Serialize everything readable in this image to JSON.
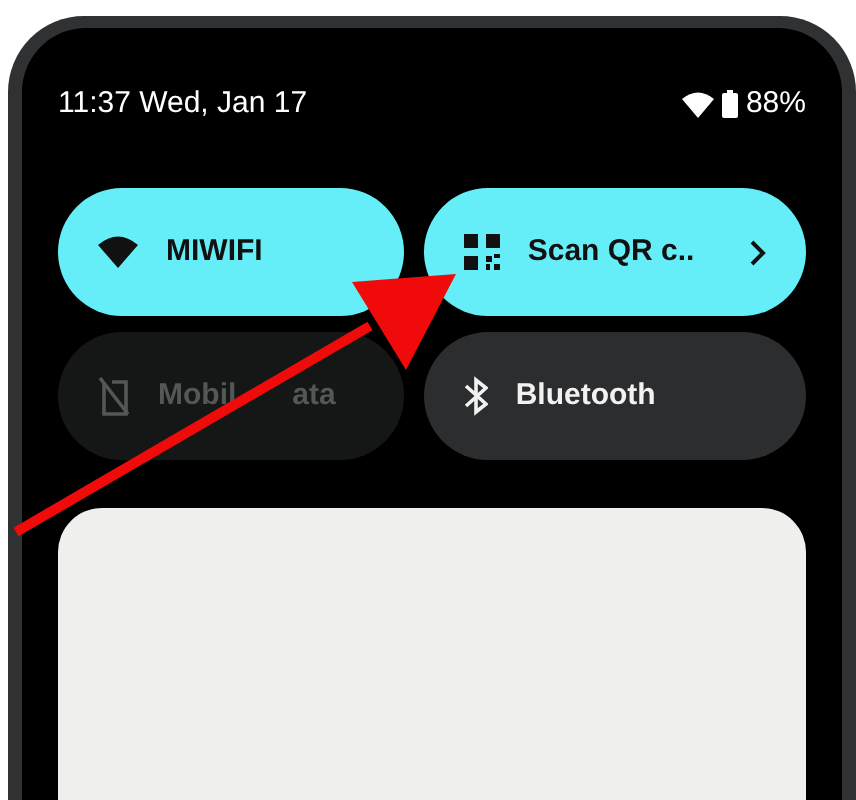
{
  "status_bar": {
    "time_date": "11:37 Wed, Jan 17",
    "battery": "88%"
  },
  "tiles": [
    {
      "kind": "wifi",
      "label": "MIWIFI",
      "on": true,
      "disabled": false,
      "chevron": false
    },
    {
      "kind": "qr",
      "label": "Scan QR c..",
      "on": true,
      "disabled": false,
      "chevron": true
    },
    {
      "kind": "mobile",
      "label": "Mobil",
      "label_end": "ata",
      "on": false,
      "disabled": true,
      "chevron": false
    },
    {
      "kind": "bluetooth",
      "label": "Bluetooth",
      "on": false,
      "disabled": false,
      "chevron": false
    }
  ]
}
